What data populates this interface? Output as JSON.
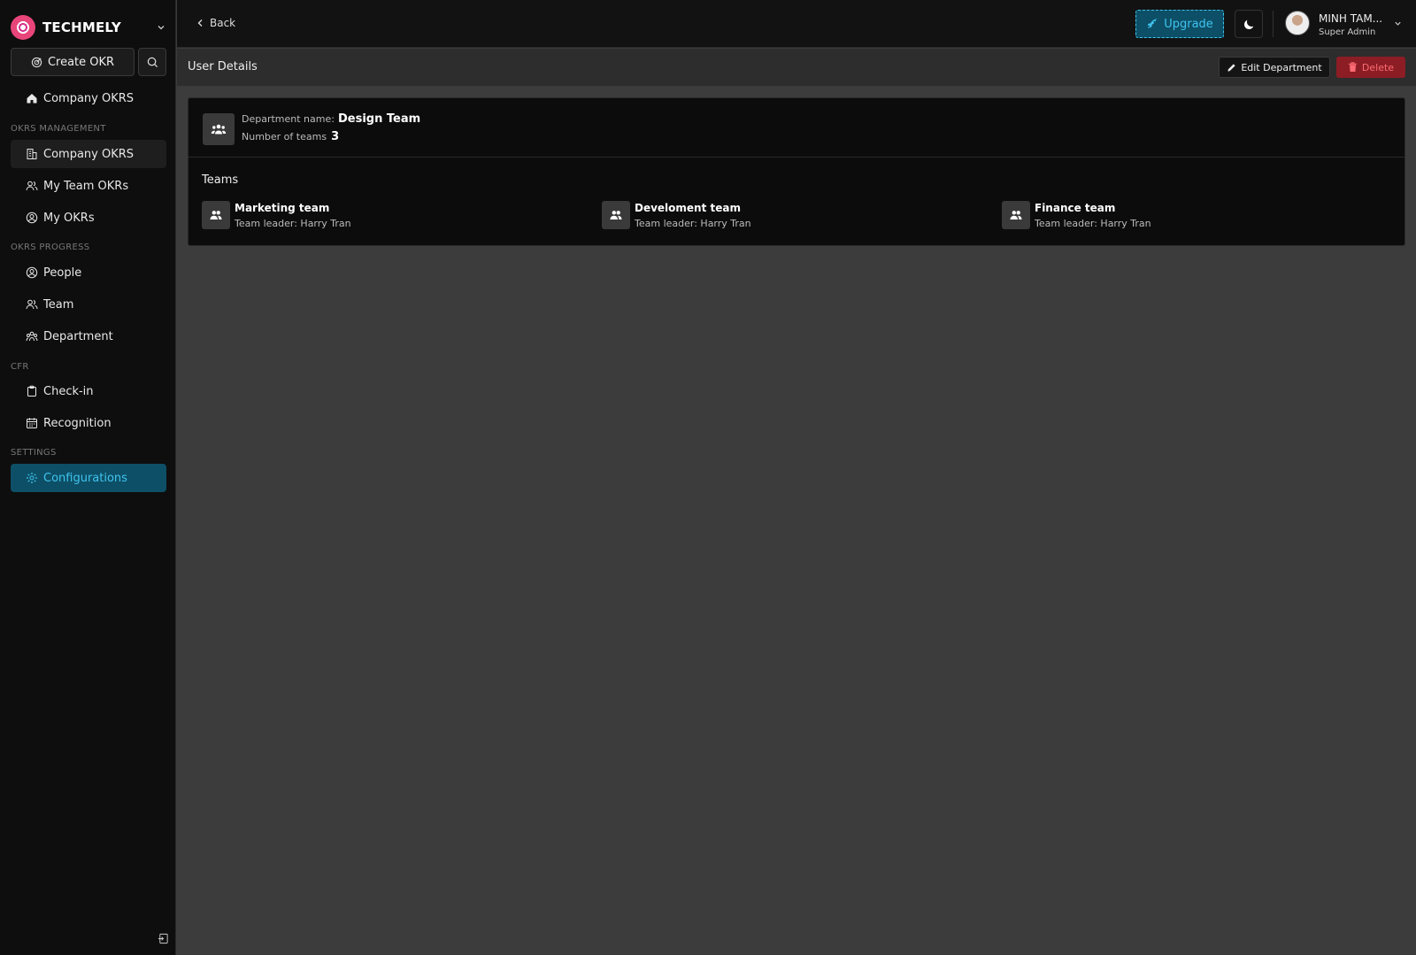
{
  "app": {
    "name": "TECHMELY"
  },
  "sidebar": {
    "create_label": "Create OKR",
    "home_item": "Company OKRS",
    "sections": {
      "okrs_management": "OKRS MANAGEMENT",
      "okrs_progress": "OKRS PROGRESS",
      "cfr": "CFR",
      "settings": "SETTINGS"
    },
    "items": {
      "company_okrs": "Company OKRS",
      "my_team_okrs": "My Team OKRs",
      "my_okrs": "My OKRs",
      "people": "People",
      "team": "Team",
      "department": "Department",
      "check_in": "Check-in",
      "recognition": "Recognition",
      "configurations": "Configurations"
    }
  },
  "topbar": {
    "back_label": "Back",
    "upgrade_label": "Upgrade",
    "user_name": "MINH TAM...",
    "user_role": "Super Admin"
  },
  "page": {
    "title": "User Details",
    "edit_label": "Edit Department",
    "delete_label": "Delete"
  },
  "department": {
    "name_label": "Department name:",
    "name": "Design Team",
    "count_label": "Number of teams",
    "count": "3"
  },
  "teams_section": {
    "title": "Teams",
    "leader_prefix": "Team leader:",
    "items": [
      {
        "name": "Marketing team",
        "leader": "Team leader: Harry Tran"
      },
      {
        "name": "Develoment team",
        "leader": "Team leader: Harry Tran"
      },
      {
        "name": "Finance team",
        "leader": "Team leader: Harry Tran"
      }
    ]
  },
  "colors": {
    "accent": "#3fc3ef",
    "accent_bg": "#0d4f66",
    "danger": "#8c1d24",
    "danger_text": "#ff6b75"
  }
}
